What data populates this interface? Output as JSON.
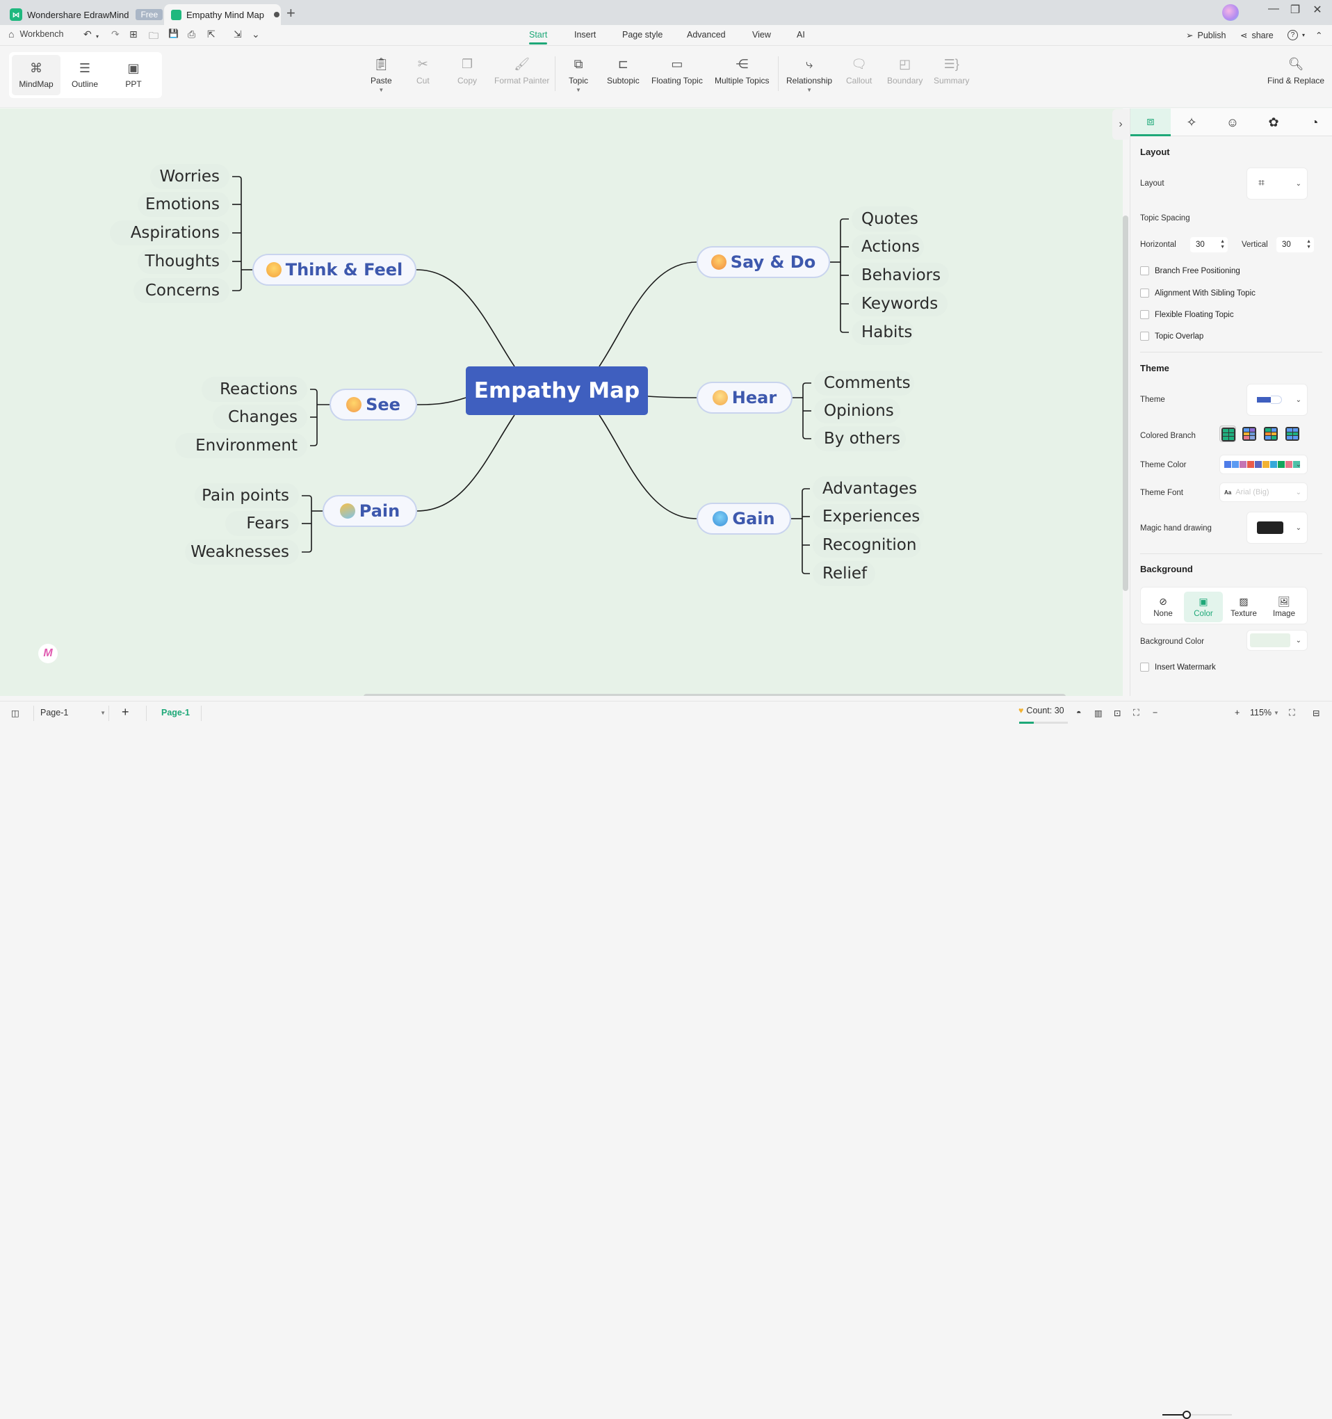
{
  "titlebar": {
    "app_name": "Wondershare EdrawMind",
    "app_badge": "Free",
    "doc_tab": "Empathy Mind Map",
    "new_tab": "+",
    "minimize": "—",
    "restore": "❐",
    "close": "✕"
  },
  "quick_access": {
    "workbench": "Workbench",
    "undo": "↶",
    "redo": "↷",
    "new": "⊞",
    "open": "🗀",
    "save": "💾",
    "print": "⎙",
    "export": "⇱",
    "import": "⇲",
    "more": "⌄"
  },
  "menu_tabs": [
    "Start",
    "Insert",
    "Page style",
    "Advanced",
    "View",
    "AI"
  ],
  "menu_active": "Start",
  "right_actions": {
    "publish": "Publish",
    "share": "share",
    "help": "?",
    "collapse": "⌃"
  },
  "view_switch": [
    {
      "label": "MindMap",
      "icon": "⌘",
      "active": true
    },
    {
      "label": "Outline",
      "icon": "☰",
      "active": false
    },
    {
      "label": "PPT",
      "icon": "▣",
      "active": false
    }
  ],
  "ribbon": {
    "paste": "Paste",
    "cut": "Cut",
    "copy": "Copy",
    "format_painter": "Format Painter",
    "topic": "Topic",
    "subtopic": "Subtopic",
    "floating_topic": "Floating Topic",
    "multiple_topics": "Multiple Topics",
    "relationship": "Relationship",
    "callout": "Callout",
    "boundary": "Boundary",
    "summary": "Summary",
    "find_replace": "Find & Replace"
  },
  "mindmap": {
    "central": "Empathy Map",
    "branches": [
      {
        "id": "think",
        "label": "Think & Feel",
        "children": [
          "Worries",
          "Emotions",
          "Aspirations",
          "Thoughts",
          "Concerns"
        ]
      },
      {
        "id": "see",
        "label": "See",
        "children": [
          "Reactions",
          "Changes",
          "Environment"
        ]
      },
      {
        "id": "pain",
        "label": "Pain",
        "children": [
          "Pain points",
          "Fears",
          "Weaknesses"
        ]
      },
      {
        "id": "say",
        "label": "Say & Do",
        "children": [
          "Quotes",
          "Actions",
          "Behaviors",
          "Keywords",
          "Habits"
        ]
      },
      {
        "id": "hear",
        "label": "Hear",
        "children": [
          "Comments",
          "Opinions",
          "By others"
        ]
      },
      {
        "id": "gain",
        "label": "Gain",
        "children": [
          "Advantages",
          "Experiences",
          "Recognition",
          "Relief"
        ]
      }
    ]
  },
  "panel": {
    "toggle": "›",
    "layout_section": "Layout",
    "layout_label": "Layout",
    "topic_spacing": "Topic Spacing",
    "horizontal_label": "Horizontal",
    "horizontal_value": "30",
    "vertical_label": "Vertical",
    "vertical_value": "30",
    "checkboxes": [
      "Branch Free Positioning",
      "Alignment With Sibling Topic",
      "Flexible Floating Topic",
      "Topic Overlap"
    ],
    "theme_section": "Theme",
    "theme_label": "Theme",
    "colored_branch_label": "Colored Branch",
    "theme_color_label": "Theme Color",
    "theme_colors": [
      "#4f7de8",
      "#5b9af2",
      "#c574b4",
      "#ea5c4a",
      "#5a66c0",
      "#f2b233",
      "#35a8d9",
      "#14a45c",
      "#e9768a",
      "#4ec1a8"
    ],
    "theme_font_label": "Theme Font",
    "theme_font_value": "Arial (Big)",
    "magic_hand_label": "Magic hand drawing",
    "background_section": "Background",
    "bg_options": [
      "None",
      "Color",
      "Texture",
      "Image"
    ],
    "bg_active": "Color",
    "bg_color_label": "Background Color",
    "bg_color": "#e7f2e8",
    "watermark": "Insert Watermark"
  },
  "statusbar": {
    "page_select": "Page-1",
    "add_page": "+",
    "page_tab": "Page-1",
    "count": "Count: 30",
    "zoom": "115%",
    "zoom_level": 0.35
  },
  "colors": {
    "accent": "#1ea878",
    "central": "#3f5fbf",
    "main_text": "#3d58ad",
    "canvas": "#e7f2e8"
  }
}
